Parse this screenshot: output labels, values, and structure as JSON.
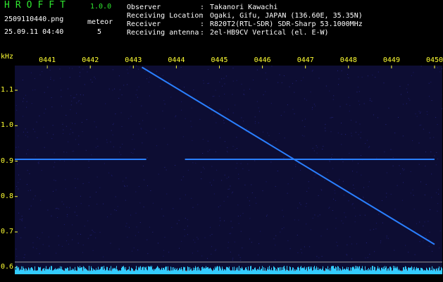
{
  "header": {
    "app_name": "HROFFT",
    "app_version": "1.0.0",
    "filename": "2509110440.png",
    "timestamp": "25.09.11 04:40",
    "meteor_label": "meteor",
    "meteor_count": "5",
    "info": [
      {
        "label": "Observer",
        "value": "Takanori Kawachi"
      },
      {
        "label": "Receiving Location",
        "value": "Ogaki, Gifu, JAPAN (136.60E, 35.35N)"
      },
      {
        "label": "Receiver",
        "value": "R820T2(RTL-SDR) SDR-Sharp 53.1000MHz"
      },
      {
        "label": "Receiving antenna",
        "value": "2el-HB9CV Vertical (el. E-W)"
      }
    ]
  },
  "colors": {
    "title_green": "#2fe62f",
    "axis_yellow": "#ffff33",
    "background": "#0d0d33",
    "signal_blue": "#2a7fff",
    "noise_cyan": "#33ccff"
  },
  "chart_data": {
    "type": "heatmap",
    "xlabel": "",
    "ylabel": "kHz",
    "x_ticks": [
      "0441",
      "0442",
      "0443",
      "0444",
      "0445",
      "0446",
      "0447",
      "0448",
      "0449",
      "0450"
    ],
    "y_ticks": [
      "1.1",
      "1.0",
      "0.9",
      "0.8",
      "0.7",
      "0.6"
    ],
    "ylim": [
      0.6,
      1.15
    ],
    "signals": [
      {
        "kind": "carrier",
        "freq_khz": 0.905,
        "segments": [
          [
            "0440.0",
            "0443.3"
          ],
          [
            "0444.2",
            "0450.0"
          ]
        ]
      },
      {
        "kind": "drifting-tone",
        "start": {
          "time": "0443.2",
          "freq_khz": 1.165
        },
        "end": {
          "time": "0450.0",
          "freq_khz": 0.665
        }
      }
    ]
  }
}
